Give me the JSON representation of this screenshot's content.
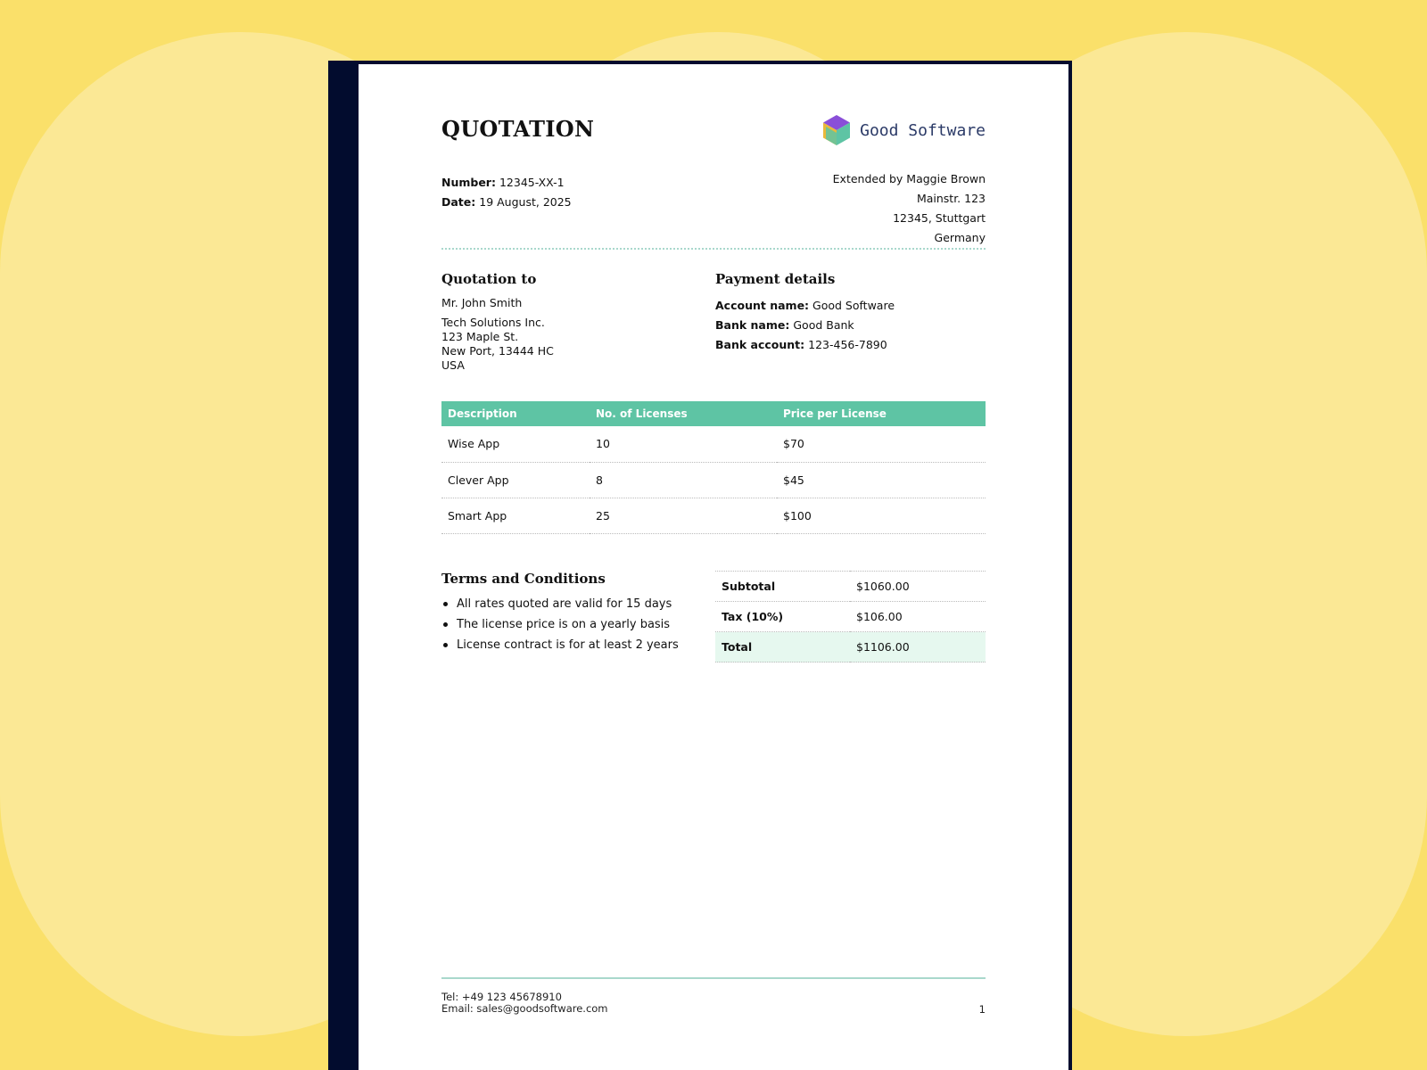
{
  "colors": {
    "background": "#fae06a",
    "frame": "#020c2e",
    "accent": "#5ec4a4",
    "total_highlight": "#e6f8ef",
    "logo_text": "#2b3a67"
  },
  "header": {
    "title": "QUOTATION",
    "logo_name": "Good Software",
    "logo_icon": "hexagon-cube-icon"
  },
  "meta": {
    "number_label": "Number:",
    "number": "12345-XX-1",
    "date_label": "Date:",
    "date": "19 August, 2025"
  },
  "sender": {
    "lines": [
      "Extended by Maggie Brown",
      "Mainstr. 123",
      "12345, Stuttgart",
      "Germany"
    ]
  },
  "quotation_to": {
    "title": "Quotation to",
    "name": "Mr. John Smith",
    "address": [
      "Tech Solutions Inc.",
      "123 Maple St.",
      "New Port, 13444 HC",
      "USA"
    ]
  },
  "payment": {
    "title": "Payment details",
    "rows": [
      {
        "label": "Account name:",
        "value": "Good Software"
      },
      {
        "label": "Bank name:",
        "value": "Good Bank"
      },
      {
        "label": "Bank account:",
        "value": "123-456-7890"
      }
    ]
  },
  "items": {
    "headers": [
      "Description",
      "No. of Licenses",
      "Price per License"
    ],
    "rows": [
      [
        "Wise App",
        "10",
        "$70"
      ],
      [
        "Clever App",
        "8",
        "$45"
      ],
      [
        "Smart App",
        "25",
        "$100"
      ]
    ]
  },
  "terms": {
    "title": "Terms and Conditions",
    "items": [
      "All rates quoted are valid for 15 days",
      "The license price is on a yearly basis",
      "License contract is for at least 2 years"
    ]
  },
  "totals": {
    "subtotal_label": "Subtotal",
    "subtotal": "$1060.00",
    "tax_label": "Tax (10%)",
    "tax": "$106.00",
    "total_label": "Total",
    "total": "$1106.00"
  },
  "footer": {
    "tel": "Tel: +49 123 45678910",
    "email": "Email: sales@goodsoftware.com",
    "page": "1"
  }
}
